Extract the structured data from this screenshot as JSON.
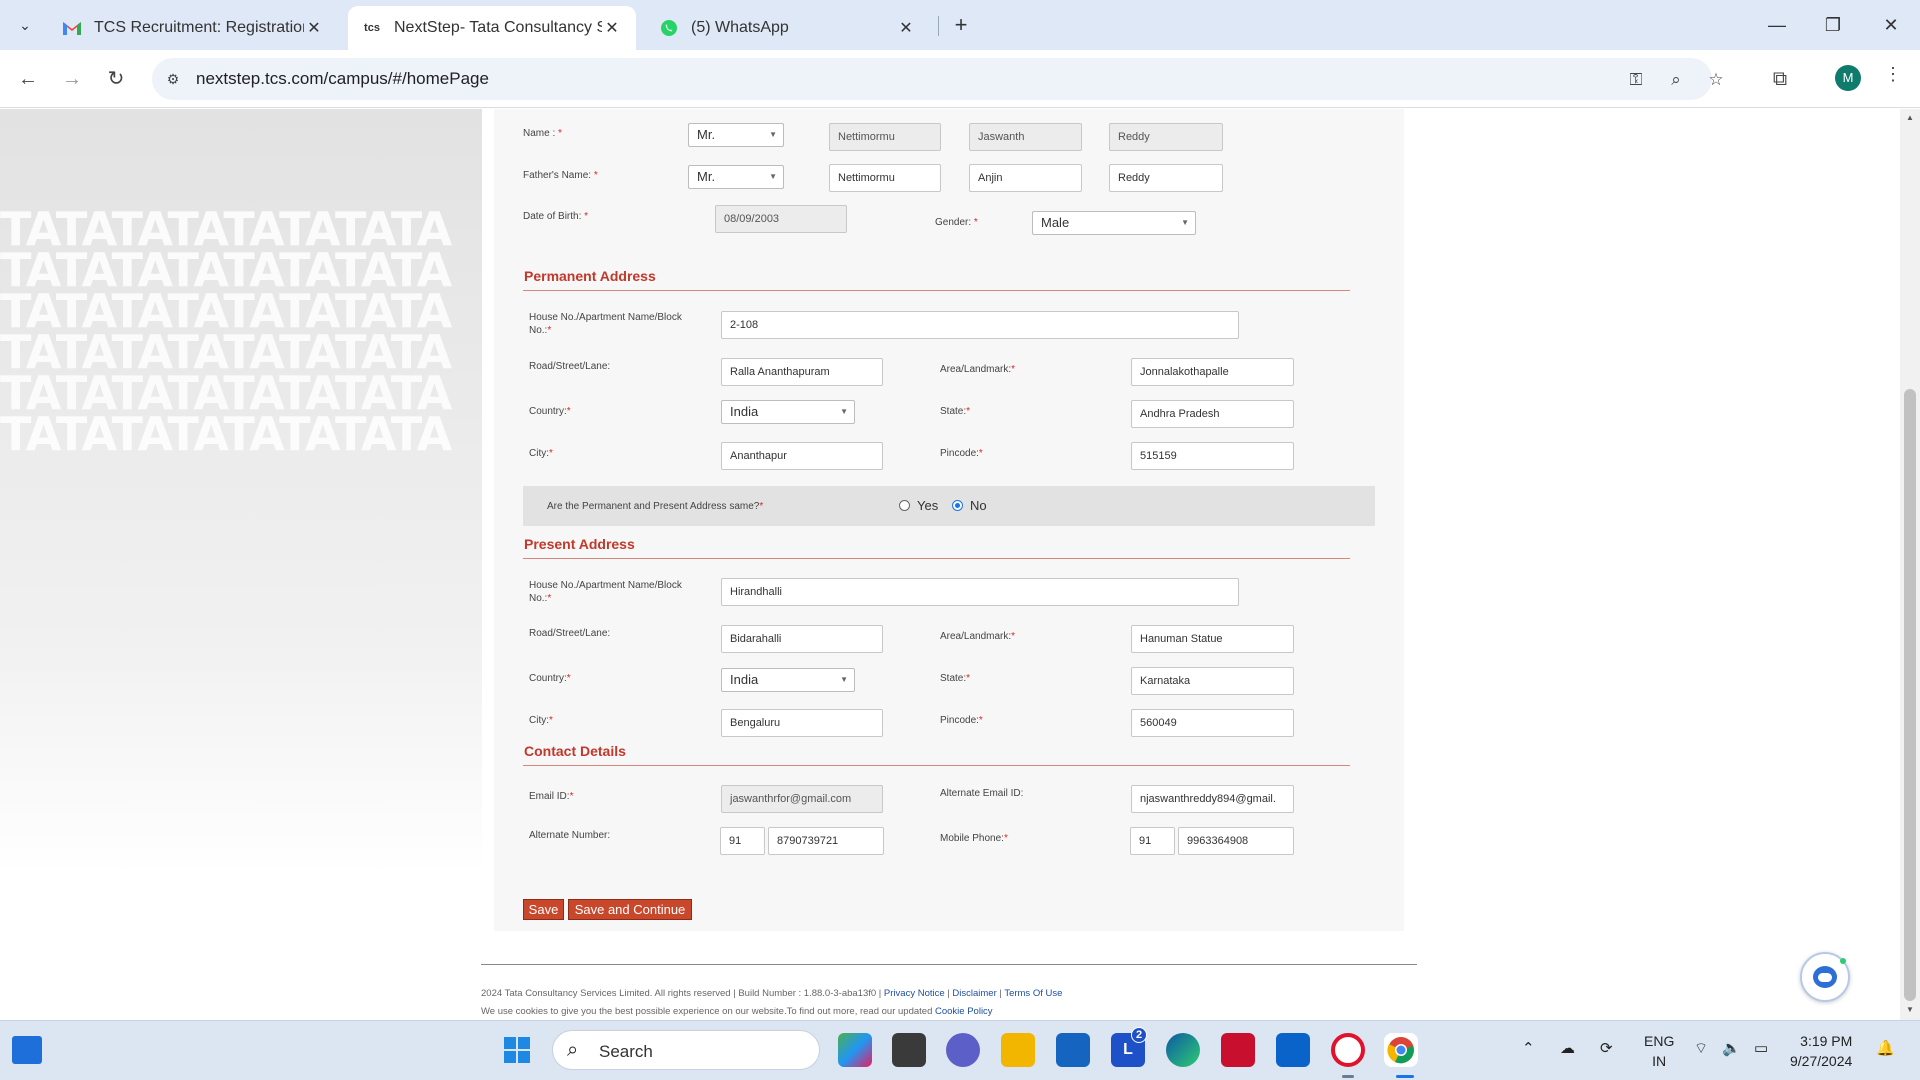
{
  "browser": {
    "tabs": [
      {
        "title": "TCS Recruitment: Registration S",
        "favicon": "gmail-icon"
      },
      {
        "title": "NextStep- Tata Consultancy Ser",
        "favicon": "tcs-icon",
        "favicon_text": "tcs"
      },
      {
        "title": "(5) WhatsApp",
        "favicon": "whatsapp-icon"
      }
    ],
    "url": "nextstep.tcs.com/campus/#/homePage",
    "profile_initial": "M"
  },
  "background": {
    "tata_text": "TATATATATATATATA"
  },
  "form": {
    "name_label": "Name :",
    "name": {
      "title": "Mr.",
      "first": "Nettimormu",
      "middle": "Jaswanth",
      "last": "Reddy"
    },
    "father_label": "Father's Name:",
    "father": {
      "title": "Mr.",
      "first": "Nettimormu",
      "middle": "Anjin",
      "last": "Reddy"
    },
    "dob_label": "Date of Birth:",
    "dob": "08/09/2003",
    "gender_label": "Gender:",
    "gender": "Male",
    "permanent": {
      "title": "Permanent Address",
      "house_label": "House No./Apartment Name/Block No.:",
      "house": "2-108",
      "road_label": "Road/Street/Lane:",
      "road": "Ralla Ananthapuram",
      "area_label": "Area/Landmark:",
      "area": "Jonnalakothapalle",
      "country_label": "Country:",
      "country": "India",
      "state_label": "State:",
      "state": "Andhra Pradesh",
      "city_label": "City:",
      "city": "Ananthapur",
      "pincode_label": "Pincode:",
      "pincode": "515159"
    },
    "same_address": {
      "question": "Are the Permanent and Present Address same?",
      "yes": "Yes",
      "no": "No",
      "selected": "No"
    },
    "present": {
      "title": "Present Address",
      "house_label": "House No./Apartment Name/Block No.:",
      "house": "Hirandhalli",
      "road_label": "Road/Street/Lane:",
      "road": "Bidarahalli",
      "area_label": "Area/Landmark:",
      "area": "Hanuman Statue",
      "country_label": "Country:",
      "country": "India",
      "state_label": "State:",
      "state": "Karnataka",
      "city_label": "City:",
      "city": "Bengaluru",
      "pincode_label": "Pincode:",
      "pincode": "560049"
    },
    "contact": {
      "title": "Contact Details",
      "email_label": "Email ID:",
      "email": "jaswanthrfor@gmail.com",
      "alt_email_label": "Alternate Email ID:",
      "alt_email": "njaswanthreddy894@gmail.",
      "alt_number_label": "Alternate Number:",
      "alt_code": "91",
      "alt_number": "8790739721",
      "mobile_label": "Mobile Phone:",
      "mobile_code": "91",
      "mobile": "9963364908"
    },
    "buttons": {
      "save": "Save",
      "save_continue": "Save and Continue"
    }
  },
  "footer": {
    "copyright": "2024 Tata Consultancy Services Limited. All rights reserved | Build Number : 1.88.0-3-aba13f0 |",
    "privacy": "Privacy Notice",
    "disclaimer": "Disclaimer",
    "terms": "Terms Of Use",
    "cookie_text": "We use cookies to give you the best possible experience on our website.To find out more, read our updated",
    "cookie_link": "Cookie Policy",
    "sep": "|"
  },
  "taskbar": {
    "search_placeholder": "Search",
    "lang_top": "ENG",
    "lang_bottom": "IN",
    "time": "3:19 PM",
    "date": "9/27/2024",
    "badge_count": "2"
  }
}
